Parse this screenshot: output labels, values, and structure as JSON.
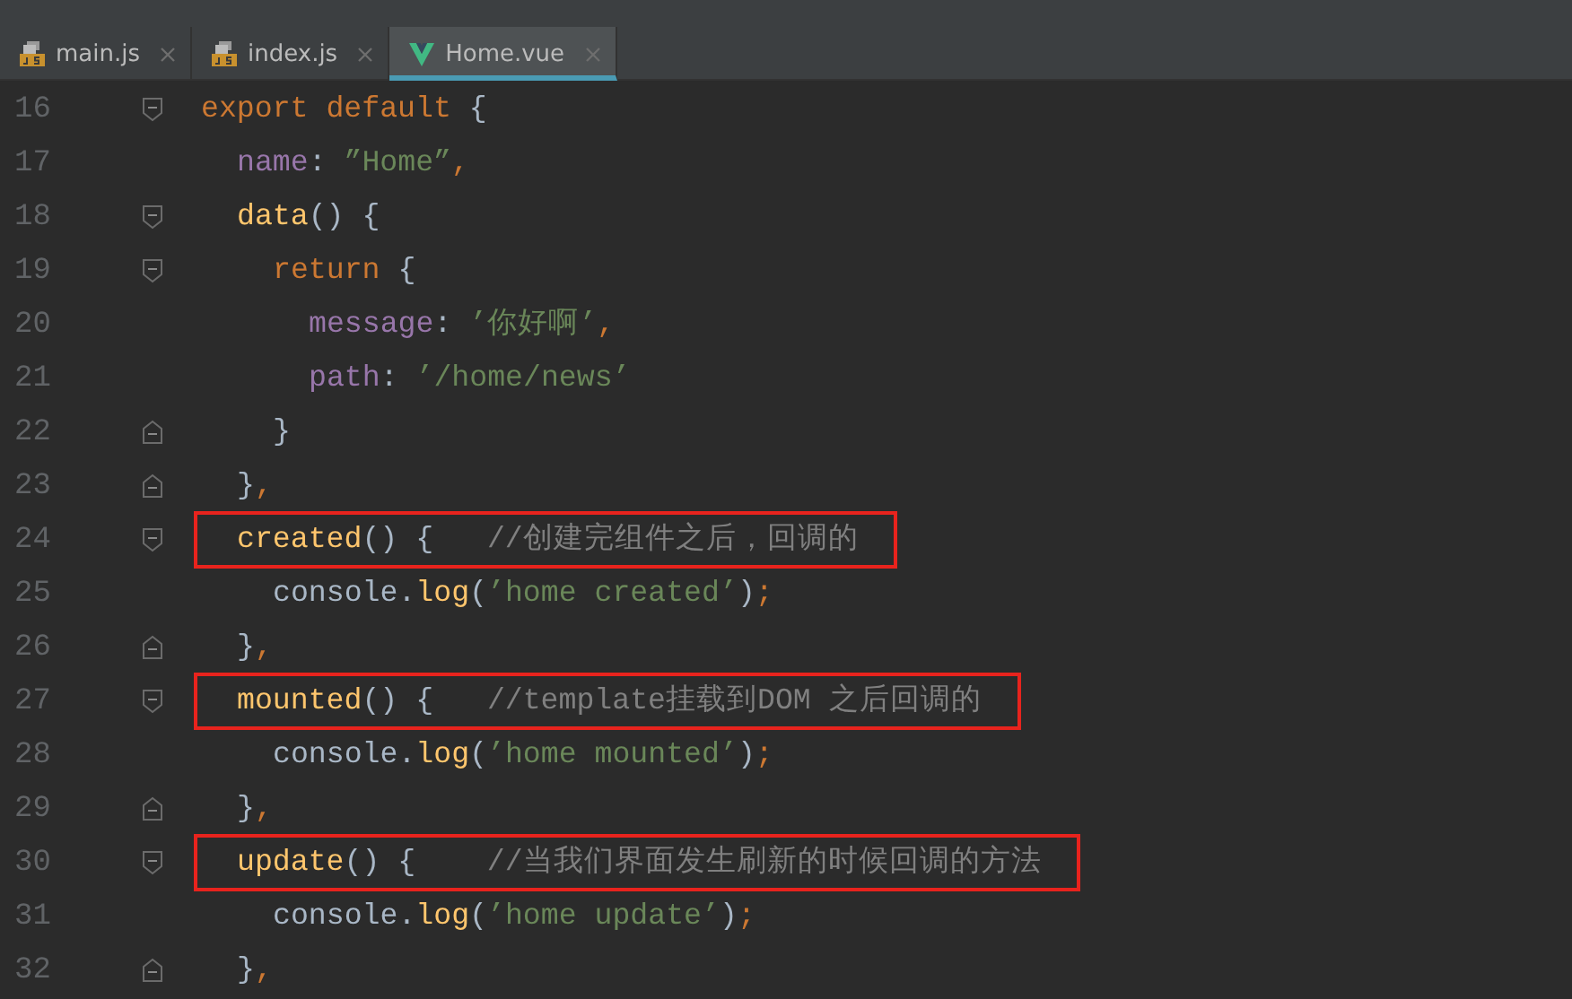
{
  "tabs": [
    {
      "label": "main.js",
      "kind": "js",
      "selected": false
    },
    {
      "label": "index.js",
      "kind": "js",
      "selected": false
    },
    {
      "label": "Home.vue",
      "kind": "vue",
      "selected": true
    }
  ],
  "lines": [
    {
      "number": "16",
      "fold": {
        "kind": "start"
      },
      "highlighted": false,
      "tokens": [
        {
          "kind": "keyword",
          "text": "export default "
        },
        {
          "kind": "plain",
          "text": "{"
        }
      ],
      "children": [
        {
          "number": "17",
          "highlighted": false,
          "tokens": [
            {
              "kind": "property",
              "text": "name"
            },
            {
              "kind": "plain",
              "text": ": "
            },
            {
              "kind": "string",
              "text": "”Home”"
            },
            {
              "kind": "keyword",
              "text": ","
            }
          ]
        },
        {
          "number": "18",
          "fold": {
            "kind": "start"
          },
          "highlighted": false,
          "tokens": [
            {
              "kind": "function",
              "text": "data"
            },
            {
              "kind": "plain",
              "text": "() {"
            }
          ],
          "children": [
            {
              "number": "19",
              "fold": {
                "kind": "start"
              },
              "highlighted": false,
              "tokens": [
                {
                  "kind": "keyword",
                  "text": "return "
                },
                {
                  "kind": "plain",
                  "text": "{"
                }
              ],
              "children": [
                {
                  "number": "20",
                  "highlighted": false,
                  "tokens": [
                    {
                      "kind": "property",
                      "text": "message"
                    },
                    {
                      "kind": "plain",
                      "text": ": "
                    },
                    {
                      "kind": "string",
                      "text": "’你好啊’"
                    },
                    {
                      "kind": "keyword",
                      "text": ","
                    }
                  ]
                },
                {
                  "number": "21",
                  "highlighted": false,
                  "tokens": [
                    {
                      "kind": "property",
                      "text": "path"
                    },
                    {
                      "kind": "plain",
                      "text": ": "
                    },
                    {
                      "kind": "string",
                      "text": "’/home/news’"
                    }
                  ]
                }
              ]
            },
            {
              "number": "22",
              "fold": {
                "kind": "end"
              },
              "highlighted": false,
              "tokens": [
                {
                  "kind": "plain",
                  "text": "}"
                }
              ]
            }
          ]
        },
        {
          "number": "23",
          "fold": {
            "kind": "end"
          },
          "highlighted": false,
          "tokens": [
            {
              "kind": "plain",
              "text": "}"
            },
            {
              "kind": "keyword",
              "text": ","
            }
          ]
        },
        {
          "number": "24",
          "fold": {
            "kind": "start"
          },
          "highlighted": true,
          "tokens": [
            {
              "kind": "function",
              "text": "created"
            },
            {
              "kind": "plain",
              "text": "() {   "
            },
            {
              "kind": "comment",
              "text": "//创建完组件之后，回调的"
            }
          ],
          "children": [
            {
              "number": "25",
              "highlighted": false,
              "tokens": [
                {
                  "kind": "plain",
                  "text": "console."
                },
                {
                  "kind": "function",
                  "text": "log"
                },
                {
                  "kind": "plain",
                  "text": "("
                },
                {
                  "kind": "string",
                  "text": "’home created’"
                },
                {
                  "kind": "plain",
                  "text": ")"
                },
                {
                  "kind": "keyword",
                  "text": ";"
                }
              ]
            }
          ]
        },
        {
          "number": "26",
          "fold": {
            "kind": "end"
          },
          "highlighted": false,
          "tokens": [
            {
              "kind": "plain",
              "text": "}"
            },
            {
              "kind": "keyword",
              "text": ","
            }
          ]
        },
        {
          "number": "27",
          "fold": {
            "kind": "start"
          },
          "highlighted": true,
          "tokens": [
            {
              "kind": "function",
              "text": "mounted"
            },
            {
              "kind": "plain",
              "text": "() {   "
            },
            {
              "kind": "comment",
              "text": "//template挂载到DOM 之后回调的"
            }
          ],
          "children": [
            {
              "number": "28",
              "highlighted": false,
              "tokens": [
                {
                  "kind": "plain",
                  "text": "console."
                },
                {
                  "kind": "function",
                  "text": "log"
                },
                {
                  "kind": "plain",
                  "text": "("
                },
                {
                  "kind": "string",
                  "text": "’home mounted’"
                },
                {
                  "kind": "plain",
                  "text": ")"
                },
                {
                  "kind": "keyword",
                  "text": ";"
                }
              ]
            }
          ]
        },
        {
          "number": "29",
          "fold": {
            "kind": "end"
          },
          "highlighted": false,
          "tokens": [
            {
              "kind": "plain",
              "text": "}"
            },
            {
              "kind": "keyword",
              "text": ","
            }
          ]
        },
        {
          "number": "30",
          "fold": {
            "kind": "start"
          },
          "highlighted": true,
          "tokens": [
            {
              "kind": "function",
              "text": "update"
            },
            {
              "kind": "plain",
              "text": "() {    "
            },
            {
              "kind": "comment",
              "text": "//当我们界面发生刷新的时候回调的方法"
            }
          ],
          "children": [
            {
              "number": "31",
              "highlighted": false,
              "tokens": [
                {
                  "kind": "plain",
                  "text": "console."
                },
                {
                  "kind": "function",
                  "text": "log"
                },
                {
                  "kind": "plain",
                  "text": "("
                },
                {
                  "kind": "string",
                  "text": "’home update’"
                },
                {
                  "kind": "plain",
                  "text": ")"
                },
                {
                  "kind": "keyword",
                  "text": ";"
                }
              ]
            }
          ]
        },
        {
          "number": "32",
          "fold": {
            "kind": "end"
          },
          "highlighted": false,
          "tokens": [
            {
              "kind": "plain",
              "text": "}"
            },
            {
              "kind": "keyword",
              "text": ","
            }
          ]
        }
      ]
    }
  ]
}
